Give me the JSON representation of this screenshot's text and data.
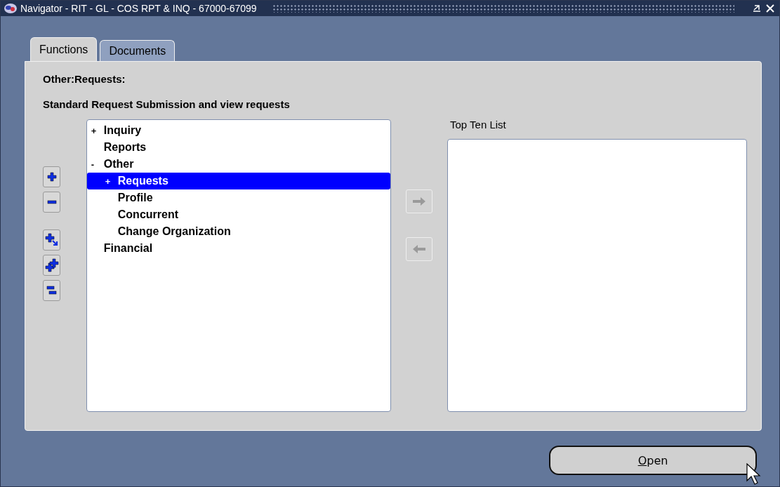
{
  "window": {
    "title": "Navigator - RIT - GL - COS RPT & INQ - 67000-67099"
  },
  "tabs": [
    {
      "label": "Functions",
      "selected": true
    },
    {
      "label": "Documents",
      "selected": false
    }
  ],
  "path": "Other:Requests:",
  "description": "Standard Request Submission and view requests",
  "tree": [
    {
      "marker": "+",
      "label": "Inquiry",
      "selected": false
    },
    {
      "label": "Reports",
      "selected": false
    },
    {
      "marker": "-",
      "label": "Other",
      "selected": false,
      "children": [
        {
          "marker": "+",
          "label": "Requests",
          "selected": true
        },
        {
          "label": "Profile",
          "selected": false
        },
        {
          "label": "Concurrent",
          "selected": false
        },
        {
          "label": "Change Organization",
          "selected": false
        }
      ]
    },
    {
      "label": "Financial",
      "selected": false
    }
  ],
  "move_buttons": [
    {
      "kind": "right",
      "disabled": true
    },
    {
      "kind": "left",
      "disabled": true
    }
  ],
  "top_ten": {
    "label": "Top Ten List"
  },
  "open_button": {
    "label": "Open"
  }
}
